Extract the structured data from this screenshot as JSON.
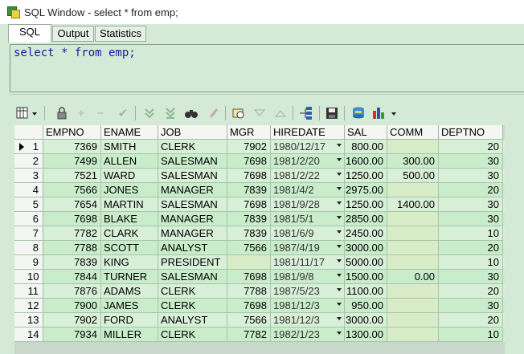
{
  "window": {
    "title": "SQL Window - select * from emp;"
  },
  "tabs": [
    {
      "label": "SQL"
    },
    {
      "label": "Output"
    },
    {
      "label": "Statistics"
    }
  ],
  "editor": {
    "sql": "select * from emp;"
  },
  "toolbar": {
    "icons": [
      "grid-options-icon",
      "lock-icon",
      "insert-record-icon",
      "delete-record-icon",
      "post-record-icon",
      "fetch-next-icon",
      "fetch-last-icon",
      "find-icon",
      "clear-icon",
      "query-by-example-icon",
      "filter-icon",
      "sort-icon",
      "export-icon",
      "save-icon",
      "print-icon",
      "chart-icon"
    ]
  },
  "grid": {
    "columns": [
      "EMPNO",
      "ENAME",
      "JOB",
      "MGR",
      "HIREDATE",
      "SAL",
      "COMM",
      "DEPTNO"
    ],
    "rows": [
      {
        "no": "1",
        "empno": "7369",
        "ename": "SMITH",
        "job": "CLERK",
        "mgr": "7902",
        "hiredate": "1980/12/17",
        "sal": "800.00",
        "comm": "",
        "deptno": "20"
      },
      {
        "no": "2",
        "empno": "7499",
        "ename": "ALLEN",
        "job": "SALESMAN",
        "mgr": "7698",
        "hiredate": "1981/2/20",
        "sal": "1600.00",
        "comm": "300.00",
        "deptno": "30"
      },
      {
        "no": "3",
        "empno": "7521",
        "ename": "WARD",
        "job": "SALESMAN",
        "mgr": "7698",
        "hiredate": "1981/2/22",
        "sal": "1250.00",
        "comm": "500.00",
        "deptno": "30"
      },
      {
        "no": "4",
        "empno": "7566",
        "ename": "JONES",
        "job": "MANAGER",
        "mgr": "7839",
        "hiredate": "1981/4/2",
        "sal": "2975.00",
        "comm": "",
        "deptno": "20"
      },
      {
        "no": "5",
        "empno": "7654",
        "ename": "MARTIN",
        "job": "SALESMAN",
        "mgr": "7698",
        "hiredate": "1981/9/28",
        "sal": "1250.00",
        "comm": "1400.00",
        "deptno": "30"
      },
      {
        "no": "6",
        "empno": "7698",
        "ename": "BLAKE",
        "job": "MANAGER",
        "mgr": "7839",
        "hiredate": "1981/5/1",
        "sal": "2850.00",
        "comm": "",
        "deptno": "30"
      },
      {
        "no": "7",
        "empno": "7782",
        "ename": "CLARK",
        "job": "MANAGER",
        "mgr": "7839",
        "hiredate": "1981/6/9",
        "sal": "2450.00",
        "comm": "",
        "deptno": "10"
      },
      {
        "no": "8",
        "empno": "7788",
        "ename": "SCOTT",
        "job": "ANALYST",
        "mgr": "7566",
        "hiredate": "1987/4/19",
        "sal": "3000.00",
        "comm": "",
        "deptno": "20"
      },
      {
        "no": "9",
        "empno": "7839",
        "ename": "KING",
        "job": "PRESIDENT",
        "mgr": "",
        "hiredate": "1981/11/17",
        "sal": "5000.00",
        "comm": "",
        "deptno": "10"
      },
      {
        "no": "10",
        "empno": "7844",
        "ename": "TURNER",
        "job": "SALESMAN",
        "mgr": "7698",
        "hiredate": "1981/9/8",
        "sal": "1500.00",
        "comm": "0.00",
        "deptno": "30"
      },
      {
        "no": "11",
        "empno": "7876",
        "ename": "ADAMS",
        "job": "CLERK",
        "mgr": "7788",
        "hiredate": "1987/5/23",
        "sal": "1100.00",
        "comm": "",
        "deptno": "20"
      },
      {
        "no": "12",
        "empno": "7900",
        "ename": "JAMES",
        "job": "CLERK",
        "mgr": "7698",
        "hiredate": "1981/12/3",
        "sal": "950.00",
        "comm": "",
        "deptno": "30"
      },
      {
        "no": "13",
        "empno": "7902",
        "ename": "FORD",
        "job": "ANALYST",
        "mgr": "7566",
        "hiredate": "1981/12/3",
        "sal": "3000.00",
        "comm": "",
        "deptno": "20"
      },
      {
        "no": "14",
        "empno": "7934",
        "ename": "MILLER",
        "job": "CLERK",
        "mgr": "7782",
        "hiredate": "1982/1/23",
        "sal": "1300.00",
        "comm": "",
        "deptno": "10"
      }
    ]
  }
}
